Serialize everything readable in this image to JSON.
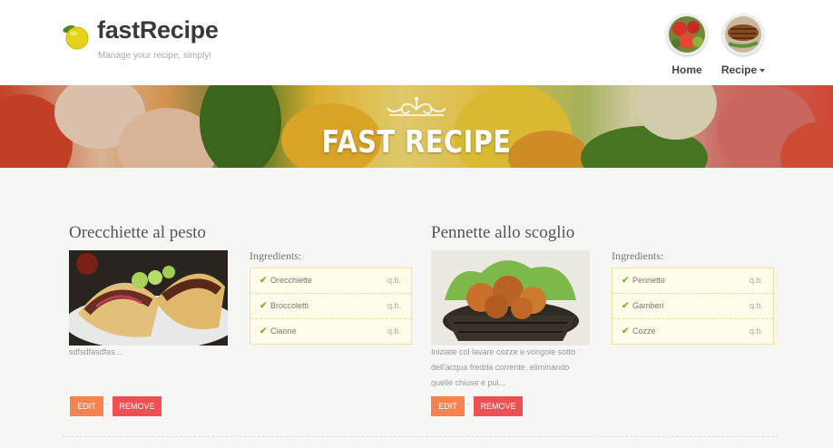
{
  "brand": {
    "name": "fastRecipe",
    "tagline": "Manage your recipe, simply!",
    "logo_icon": "lemon-icon"
  },
  "nav": {
    "items": [
      {
        "label": "Home",
        "icon": "vegetables-thumbnail"
      },
      {
        "label": "Recipe",
        "icon": "grilled-meat-thumbnail",
        "dropdown": true
      }
    ]
  },
  "banner": {
    "title": "FAST RECIPE",
    "ornament_icon": "flourish-ornament"
  },
  "recipes": [
    {
      "title": "Orecchiette al pesto",
      "description": "sdfsdfasdfas...",
      "photo_icon": "tacos-photo",
      "ingredients_heading": "Ingredients:",
      "ingredients": [
        {
          "name": "Orecchiette",
          "qty": "q.b."
        },
        {
          "name": "Broccoletti",
          "qty": "q.b."
        },
        {
          "name": "Ciaone",
          "qty": "q.b."
        }
      ],
      "edit_label": "EDIT",
      "separator": "-",
      "remove_label": "REMOVE"
    },
    {
      "title": "Pennette allo scoglio",
      "description": "Iniziate col lavare cozze e vongole sotto dell'acqua fredda corrente, eliminando quelle chiuse e pul...",
      "photo_icon": "fried-chicken-basket-photo",
      "ingredients_heading": "Ingredients:",
      "ingredients": [
        {
          "name": "Pennette",
          "qty": "q.b."
        },
        {
          "name": "Gamberi",
          "qty": "q.b."
        },
        {
          "name": "Cozze",
          "qty": "q.b."
        }
      ],
      "edit_label": "EDIT",
      "separator": "-",
      "remove_label": "REMOVE"
    }
  ],
  "colors": {
    "edit_button": "#f5834f",
    "remove_button": "#f05053",
    "ingredient_box_bg": "#fefbe8",
    "check": "#7cb342"
  }
}
